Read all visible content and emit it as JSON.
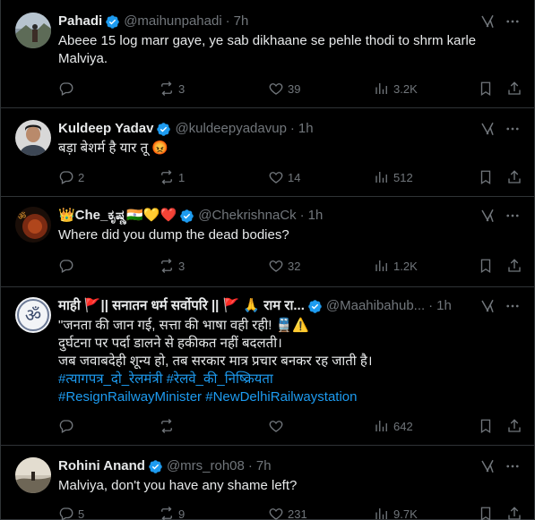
{
  "tweets": [
    {
      "name": "Pahadi",
      "handle": "@maihunpahadi",
      "time": "7h",
      "text_lines": [
        "Abeee 15 log marr gaye, ye sab dikhaane se pehle thodi to shrm karle",
        "Malviya."
      ],
      "replies": "",
      "retweets": "3",
      "likes": "39",
      "views": "3.2K",
      "avatar_icon": "mountain-person-avatar"
    },
    {
      "name": "Kuldeep Yadav",
      "handle": "@kuldeepyadavup",
      "time": "1h",
      "text_lines": [
        "बड़ा बेशर्म है यार तू 😡"
      ],
      "replies": "2",
      "retweets": "1",
      "likes": "14",
      "views": "512",
      "avatar_icon": "man-portrait-avatar"
    },
    {
      "name": "👑Che_ಕೃಷ್ಣ🇮🇳💛❤️",
      "handle": "@ChekrishnaCk",
      "time": "1h",
      "text_lines": [
        "Where did you dump the dead bodies?"
      ],
      "replies": "",
      "retweets": "3",
      "likes": "32",
      "views": "1.2K",
      "avatar_icon": "om-deity-avatar"
    },
    {
      "name": "माही 🚩|| सनातन धर्म सर्वोपरि || 🚩 🙏 राम रा...",
      "handle": "@Maahibahub...",
      "time": "1h",
      "text_lines": [
        "\"जनता की जान गई, सत्ता की भाषा वही रही! 🚆⚠️",
        "दुर्घटना पर पर्दा डालने से हकीकत नहीं बदलती।",
        "जब जवाबदेही शून्य हो, तब सरकार मात्र प्रचार बनकर रह जाती है।"
      ],
      "hashtag_lines": [
        "#त्यागपत्र_दो_रेलमंत्री #रेलवे_की_निष्क्रियता",
        "#ResignRailwayMinister #NewDelhiRailwaystation"
      ],
      "replies": "",
      "retweets": "",
      "likes": "",
      "views": "642",
      "avatar_icon": "om-symbol-avatar"
    },
    {
      "name": "Rohini Anand",
      "handle": "@mrs_roh08",
      "time": "7h",
      "text_lines": [
        "Malviya, don't you have any shame left?"
      ],
      "replies": "5",
      "retweets": "9",
      "likes": "231",
      "views": "9.7K",
      "avatar_icon": "landscape-avatar"
    }
  ],
  "colors": {
    "background": "#000000",
    "text": "#e7e9ea",
    "muted": "#71767b",
    "verified": "#1d9bf0",
    "hashtag": "#1d9bf0",
    "divider": "#2f3336"
  }
}
